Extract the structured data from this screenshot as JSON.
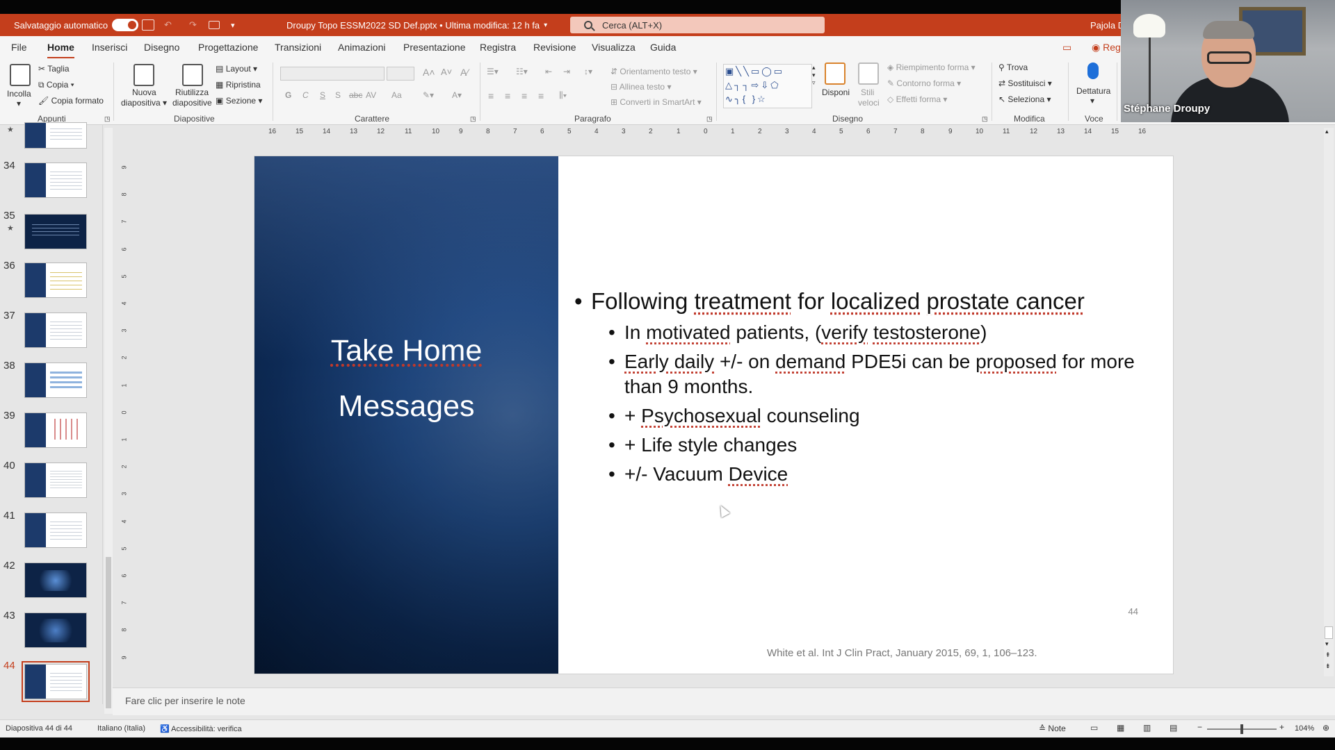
{
  "titlebar": {
    "autosave_label": "Salvataggio automatico",
    "document_title": "Droupy Topo ESSM2022 SD Def.pptx • Ultima modifica: 12 h fa",
    "search_placeholder": "Cerca (ALT+X)",
    "user_name": "Pajola D"
  },
  "menu": {
    "items": [
      "File",
      "Home",
      "Inserisci",
      "Disegno",
      "Progettazione",
      "Transizioni",
      "Animazioni",
      "Presentazione",
      "Registra",
      "Revisione",
      "Visualizza",
      "Guida"
    ],
    "active": "Home",
    "record_label": "Regi"
  },
  "ribbon": {
    "appunti": {
      "paste": "Incolla",
      "cut": "Taglia",
      "copy": "Copia",
      "format_painter": "Copia formato",
      "label": "Appunti"
    },
    "diapositive": {
      "new_slide_1": "Nuova",
      "new_slide_2": "diapositiva",
      "reuse_1": "Riutilizza",
      "reuse_2": "diapositive",
      "layout": "Layout",
      "reset": "Ripristina",
      "section": "Sezione",
      "label": "Diapositive"
    },
    "carattere": {
      "bold": "G",
      "italic": "C",
      "underline": "S",
      "shadow": "S",
      "strike": "abc",
      "spacing": "AV",
      "case": "Aa",
      "label": "Carattere"
    },
    "paragrafo": {
      "text_direction": "Orientamento testo",
      "align_text": "Allinea testo",
      "smartart": "Converti in SmartArt",
      "label": "Paragrafo"
    },
    "disegno": {
      "arrange": "Disponi",
      "styles_1": "Stili",
      "styles_2": "veloci",
      "fill": "Riempimento forma",
      "outline": "Contorno forma",
      "effects": "Effetti forma",
      "label": "Disegno"
    },
    "modifica": {
      "find": "Trova",
      "replace": "Sostituisci",
      "select": "Seleziona",
      "label": "Modifica"
    },
    "voce": {
      "dictate": "Dettatura",
      "label": "Voce"
    }
  },
  "thumbnails": [
    {
      "num": "34",
      "star": false
    },
    {
      "num": "35",
      "star": true
    },
    {
      "num": "36",
      "star": false
    },
    {
      "num": "37",
      "star": false
    },
    {
      "num": "38",
      "star": false
    },
    {
      "num": "39",
      "star": false
    },
    {
      "num": "40",
      "star": false
    },
    {
      "num": "41",
      "star": false
    },
    {
      "num": "42",
      "star": false
    },
    {
      "num": "43",
      "star": false
    },
    {
      "num": "44",
      "star": false
    }
  ],
  "slide": {
    "title_line1": "Take Home",
    "title_line2": "Messages",
    "number": "44",
    "citation": "White et al. Int J Clin Pract, January 2015, 69, 1, 106–123."
  },
  "notes": {
    "placeholder": "Fare clic per inserire le note"
  },
  "status": {
    "slide_counter": "Diapositiva 44 di 44",
    "language": "Italiano (Italia)",
    "accessibility": "Accessibilità: verifica",
    "notes_button": "Note",
    "zoom": "104%"
  },
  "webcam": {
    "participant_name": "Stéphane Droupy"
  },
  "ruler": {
    "h_ticks": [
      "16",
      "15",
      "14",
      "13",
      "12",
      "11",
      "10",
      "9",
      "8",
      "7",
      "6",
      "5",
      "4",
      "3",
      "2",
      "1",
      "0",
      "1",
      "2",
      "3",
      "4",
      "5",
      "6",
      "7",
      "8",
      "9",
      "10",
      "11",
      "12",
      "13",
      "14",
      "15",
      "16"
    ],
    "v_ticks": [
      "9",
      "8",
      "7",
      "6",
      "5",
      "4",
      "3",
      "2",
      "1",
      "0",
      "1",
      "2",
      "3",
      "4",
      "5",
      "6",
      "7",
      "8",
      "9"
    ]
  },
  "colors": {
    "accent": "#c43e1c",
    "slide_blue": "#0d2a55"
  }
}
